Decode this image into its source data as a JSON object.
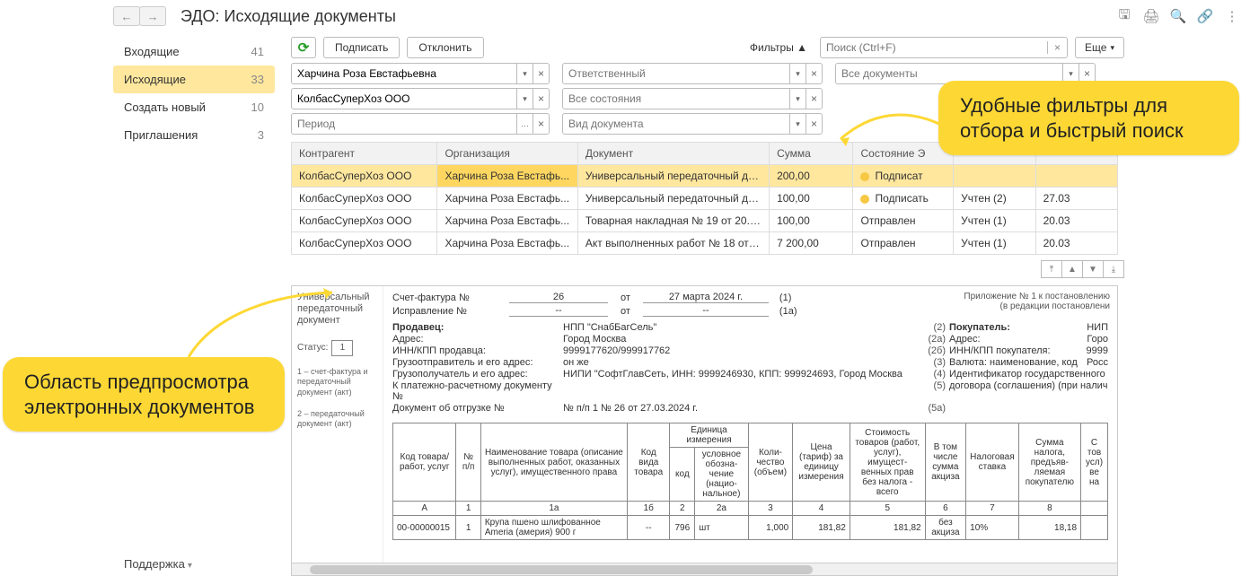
{
  "header": {
    "title": "ЭДО: Исходящие документы"
  },
  "top_icons": {
    "save": "🖫",
    "print": "🖨",
    "search": "🔍",
    "link": "🔗",
    "more": "⋮"
  },
  "sidenav": {
    "items": [
      {
        "label": "Входящие",
        "count": "41"
      },
      {
        "label": "Исходящие",
        "count": "33"
      },
      {
        "label": "Создать новый",
        "count": "10"
      },
      {
        "label": "Приглашения",
        "count": "3"
      }
    ],
    "active_index": 1,
    "support": "Поддержка"
  },
  "toolbar": {
    "sign": "Подписать",
    "reject": "Отклонить",
    "filters_label": "Фильтры ▲",
    "search_placeholder": "Поиск (Ctrl+F)",
    "more": "Еще"
  },
  "filters": {
    "row1": {
      "c1": "Харчина Роза Евстафьевна",
      "c2": "Ответственный",
      "c3": "Все документы"
    },
    "row2": {
      "c1": "КолбасСуперХоз ООО",
      "c2": "Все состояния"
    },
    "row3": {
      "c1": "Период",
      "c2": "Вид документа"
    }
  },
  "grid": {
    "headers": {
      "contr": "Контрагент",
      "org": "Организация",
      "doc": "Документ",
      "sum": "Сумма",
      "state": "Состояние Э",
      "acct": "",
      "date": ""
    },
    "rows": [
      {
        "contr": "КолбасСуперХоз ООО",
        "org": "Харчина Роза Евстафь...",
        "doc": "Универсальный передаточный доку…",
        "sum": "200,00",
        "dot": true,
        "state": "Подписат",
        "acct": "",
        "date": ""
      },
      {
        "contr": "КолбасСуперХоз ООО",
        "org": "Харчина Роза Евстафь...",
        "doc": "Универсальный передаточный доку…",
        "sum": "100,00",
        "dot": true,
        "state": "Подписать",
        "acct": "Учтен (2)",
        "date": "27.03"
      },
      {
        "contr": "КолбасСуперХоз ООО",
        "org": "Харчина Роза Евстафь...",
        "doc": "Товарная накладная № 19 от 20.03…",
        "sum": "100,00",
        "dot": false,
        "state": "Отправлен",
        "acct": "Учтен (1)",
        "date": "20.03"
      },
      {
        "contr": "КолбасСуперХоз ООО",
        "org": "Харчина Роза Евстафь...",
        "doc": "Акт выполненных работ № 18 от 20…",
        "sum": "7 200,00",
        "dot": false,
        "state": "Отправлен",
        "acct": "Учтен (1)",
        "date": "20.03"
      }
    ]
  },
  "preview": {
    "left": {
      "title1": "Универсальный",
      "title2": "передаточный",
      "title3": "документ",
      "status_label": "Статус:",
      "status_value": "1",
      "legend1": "1 – счет-фактура и передаточный документ (акт)",
      "legend2": "2 – передаточный документ (акт)"
    },
    "appx1": "Приложение № 1 к постановлению",
    "appx2": "(в редакции постановлени",
    "line_invoice": {
      "lab": "Счет-фактура №",
      "no": "26",
      "ot": "от",
      "date": "27 марта 2024 г.",
      "code": "(1)"
    },
    "line_fix": {
      "lab": "Исправление №",
      "no": "--",
      "ot": "от",
      "date": "--",
      "code": "(1а)"
    },
    "seller": {
      "h": "Продавец:",
      "val": "НПП \"СнабБагСель\"",
      "n": "(2)",
      "addr_l": "Адрес:",
      "addr_v": "Город Москва",
      "addr_n": "(2а)",
      "inn_l": "ИНН/КПП продавца:",
      "inn_v": "9999177620/999917762",
      "inn_n": "(2б)",
      "cons_l": "Грузоотправитель и его адрес:",
      "cons_v": "он же",
      "cons_n": "(3)",
      "rec_l": "Грузополучатель и его адрес:",
      "rec_v": "НИПИ \"СофтГлавСеть, ИНН: 9999246930, КПП: 999924693, Город Москва",
      "rec_n": "(4)",
      "pay_l": "К платежно-расчетному документу №",
      "pay_v": "",
      "pay_n": "(5)",
      "ship_l": "Документ об отгрузке №",
      "ship_v": "№ п/п 1 № 26 от 27.03.2024 г.",
      "ship_n": "(5а)"
    },
    "buyer": {
      "h": "Покупатель:",
      "h_v": "НИП",
      "addr_l": "Адрес:",
      "addr_v": "Горо",
      "inn_l": "ИНН/КПП покупателя:",
      "inn_v": "9999",
      "cur_l": "Валюта: наименование, код",
      "cur_v": "Росс",
      "gov_l": "Идентификатор государственного",
      "gov2_l": "договора (соглашения) (при налич"
    },
    "items_header": {
      "code": "Код товара/ работ, услуг",
      "no": "№ п/п",
      "name": "Наименование товара (описание выполненных работ, оказанных услуг), имущественного права",
      "kind": "Код вида товара",
      "unit": "Единица измерения",
      "unit_code": "код",
      "unit_name": "условное обозна-чение (нацио-нальное)",
      "qty": "Коли-чество (объем)",
      "price": "Цена (тариф) за единицу измерения",
      "cost": "Стоимость товаров (работ, услуг), имущест-венных прав без налога - всего",
      "excise": "В том числе сумма акциза",
      "tax": "Налоговая ставка",
      "taxsum": "Сумма налога, предъяв-ляемая покупателю",
      "tot": "С тов усл) ве на"
    },
    "items_numrow": {
      "a": "А",
      "b": "1",
      "c": "1а",
      "d": "1б",
      "e": "2",
      "f": "2а",
      "g": "3",
      "h": "4",
      "i": "5",
      "j": "6",
      "k": "7",
      "l": "8"
    },
    "items": [
      {
        "code": "00-00000015",
        "no": "1",
        "name": "Крупа пшено шлифованное Ameria (америя) 900 г",
        "kind": "--",
        "ucode": "796",
        "uname": "шт",
        "qty": "1,000",
        "price": "181,82",
        "cost": "181,82",
        "excise": "без акциза",
        "tax": "10%",
        "taxsum": "18,18"
      }
    ]
  },
  "callouts": {
    "c1": "Удобные фильтры для отбора и быстрый поиск",
    "c2": "Область предпросмотра электронных документов"
  }
}
